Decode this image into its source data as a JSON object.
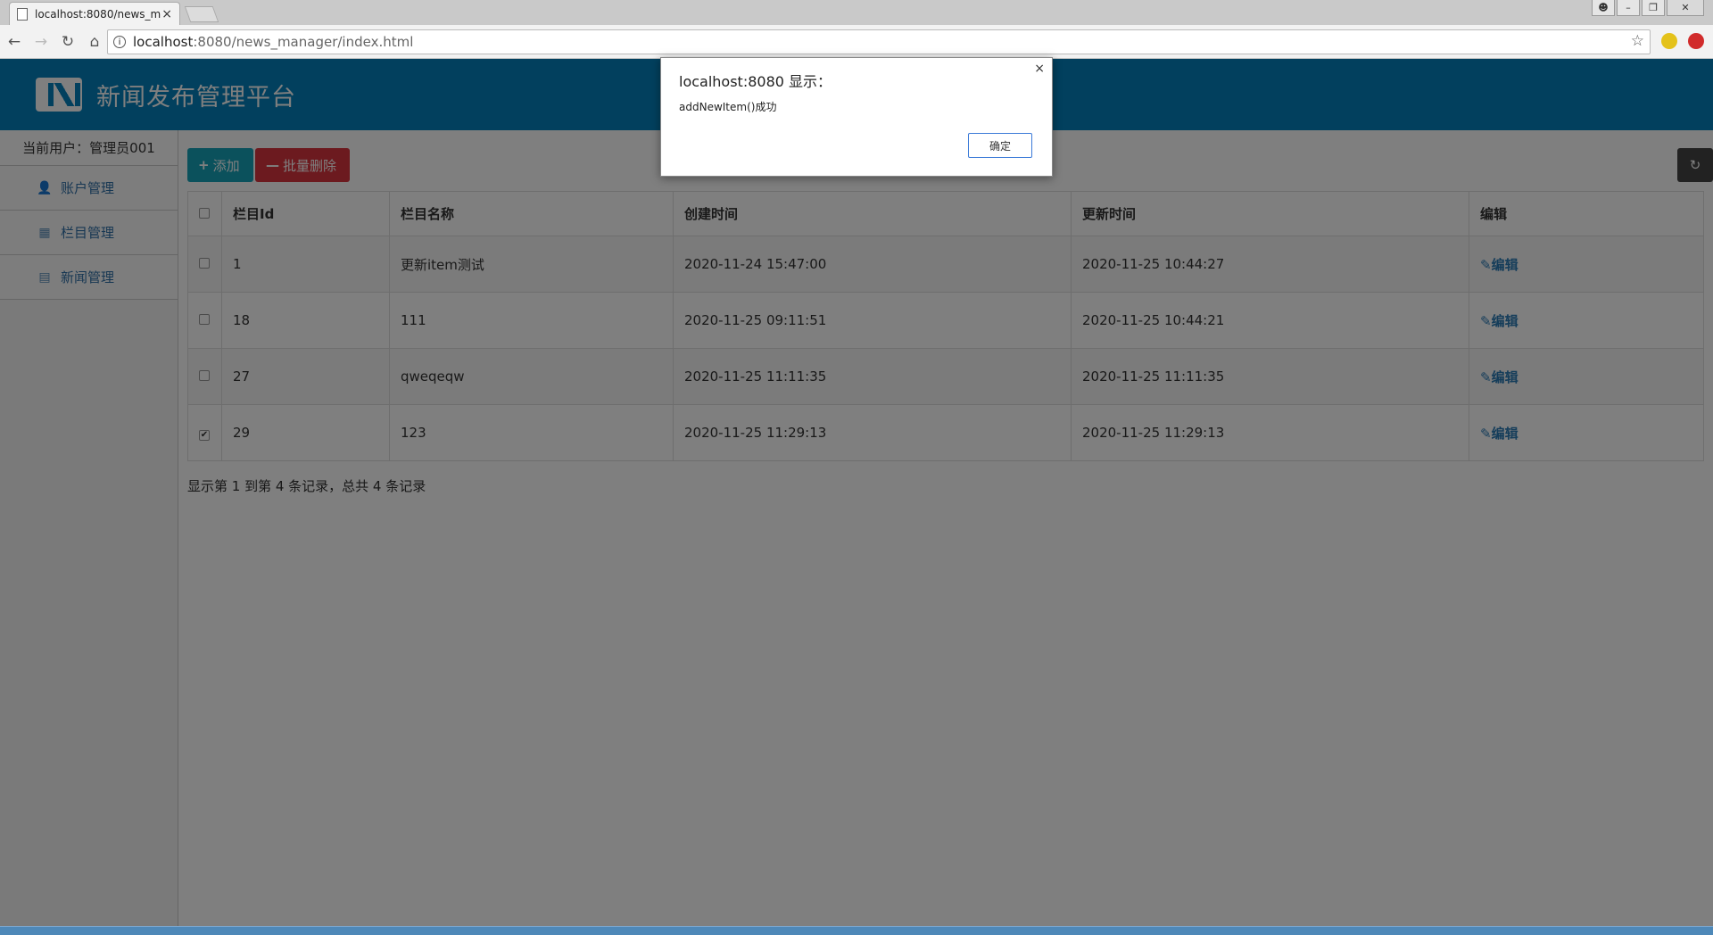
{
  "browser": {
    "tab_title": "localhost:8080/news_m",
    "tab_close": "×",
    "url_host": "localhost",
    "url_rest": ":8080/news_manager/index.html"
  },
  "header": {
    "title": "新闻发布管理平台"
  },
  "sidebar": {
    "current_user": "当前用户：管理员001",
    "items": [
      {
        "label": "账户管理",
        "icon": "user-icon"
      },
      {
        "label": "栏目管理",
        "icon": "grid-icon"
      },
      {
        "label": "新闻管理",
        "icon": "news-icon"
      }
    ]
  },
  "toolbar": {
    "add_label": "添加",
    "batch_delete_label": "批量删除"
  },
  "table": {
    "columns": [
      "栏目Id",
      "栏目名称",
      "创建时间",
      "更新时间",
      "编辑"
    ],
    "rows": [
      {
        "id": "1",
        "name": "更新item测试",
        "created": "2020-11-24 15:47:00",
        "updated": "2020-11-25 10:44:27",
        "edit": "编辑",
        "checked": false
      },
      {
        "id": "18",
        "name": "111",
        "created": "2020-11-25 09:11:51",
        "updated": "2020-11-25 10:44:21",
        "edit": "编辑",
        "checked": false
      },
      {
        "id": "27",
        "name": "qweqeqw",
        "created": "2020-11-25 11:11:35",
        "updated": "2020-11-25 11:11:35",
        "edit": "编辑",
        "checked": false
      },
      {
        "id": "29",
        "name": "123",
        "created": "2020-11-25 11:29:13",
        "updated": "2020-11-25 11:29:13",
        "edit": "编辑",
        "checked": true
      }
    ]
  },
  "pagination": {
    "summary": "显示第 1 到第 4 条记录，总共 4 条记录"
  },
  "dialog": {
    "title": "localhost:8080 显示：",
    "message": "addNewItem()成功",
    "ok_label": "确定",
    "close": "×"
  },
  "colors": {
    "header_bg": "#0580bc",
    "add_button": "#17a3b8",
    "delete_button": "#d9353f",
    "link": "#2a7ab5"
  }
}
